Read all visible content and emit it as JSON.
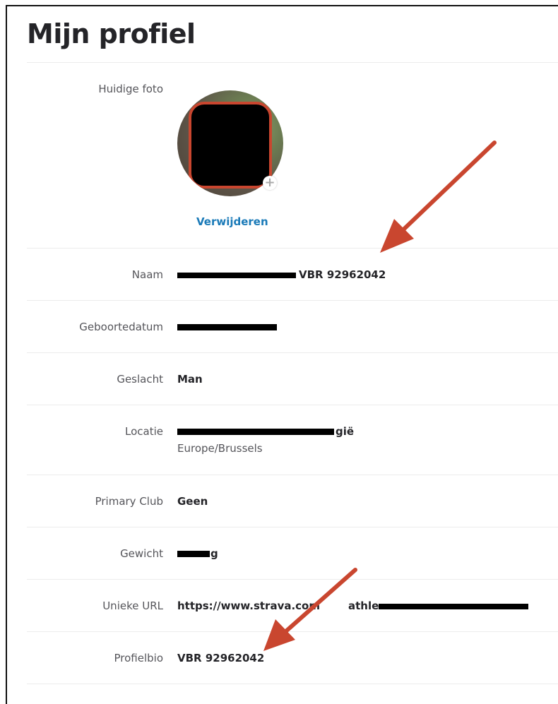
{
  "page": {
    "title": "Mijn profiel"
  },
  "profile": {
    "photo": {
      "label": "Huidige foto",
      "remove_label": "Verwijderen",
      "add_icon": "plus-icon"
    },
    "name": {
      "label": "Naam",
      "visible_suffix": "VBR 92962042"
    },
    "birthdate": {
      "label": "Geboortedatum"
    },
    "gender": {
      "label": "Geslacht",
      "value": "Man"
    },
    "location": {
      "label": "Locatie",
      "visible_suffix": "gië",
      "timezone": "Europe/Brussels"
    },
    "primary_club": {
      "label": "Primary Club",
      "value": "Geen"
    },
    "weight": {
      "label": "Gewicht",
      "visible_suffix": "g"
    },
    "url": {
      "label": "Unieke URL",
      "visible_prefix": "https://www.strava.com",
      "visible_middle": "athle"
    },
    "bio": {
      "label": "Profielbio",
      "value": "VBR 92962042"
    }
  },
  "colors": {
    "link": "#1a7ab8",
    "annotation_arrow": "#c9462f",
    "redaction": "#000000"
  }
}
